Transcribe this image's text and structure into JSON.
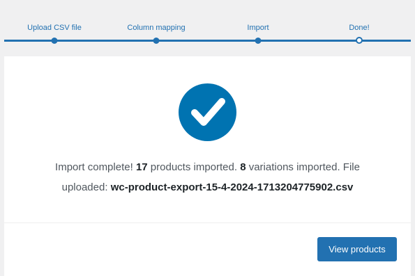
{
  "steps": [
    {
      "label": "Upload CSV file",
      "state": "done"
    },
    {
      "label": "Column mapping",
      "state": "done"
    },
    {
      "label": "Import",
      "state": "done"
    },
    {
      "label": "Done!",
      "state": "active"
    }
  ],
  "result": {
    "icon": "checkmark-icon",
    "prefix": "Import complete!",
    "products_count": "17",
    "products_text": "products imported.",
    "variations_count": "8",
    "variations_text": "variations imported. File",
    "uploaded_text": "uploaded:",
    "filename": "wc-product-export-15-4-2024-1713204775902.csv"
  },
  "actions": {
    "view_products_label": "View products"
  },
  "colors": {
    "accent": "#2271b1",
    "check_circle": "#0073b1"
  }
}
